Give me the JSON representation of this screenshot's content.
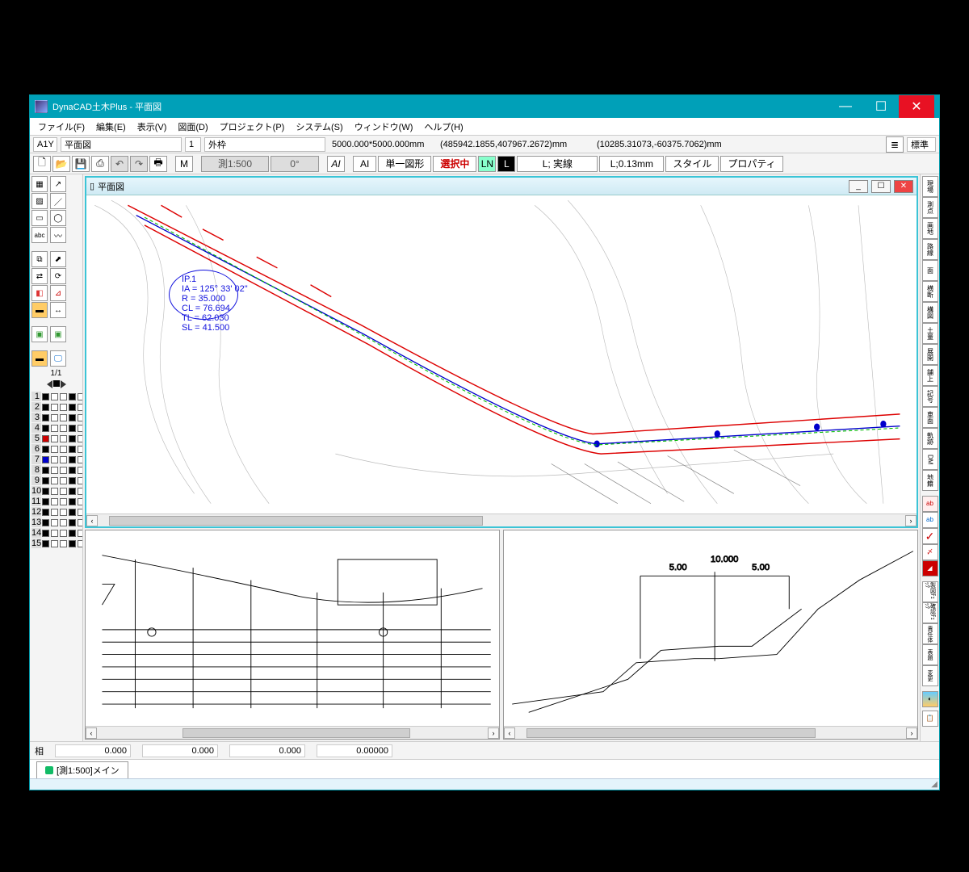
{
  "title": "DynaCAD土木Plus - 平面図",
  "menu": [
    "ファイル(F)",
    "編集(E)",
    "表示(V)",
    "図面(D)",
    "プロジェクト(P)",
    "システム(S)",
    "ウィンドウ(W)",
    "ヘルプ(H)"
  ],
  "info": {
    "cell": "A1Y",
    "name": "平面図",
    "sheet": "1",
    "frame": "外枠",
    "size": "5000.000*5000.000mm",
    "world": "(485942.1855,407967.2672)mm",
    "local": "(10285.31073,-60375.7062)mm",
    "mode": "標準"
  },
  "tool": {
    "scale": "測1:500",
    "angle": "0°",
    "ai1": "AI",
    "ai2": "AI",
    "single": "単一図形",
    "select": "選択中",
    "ln": "LN",
    "l": "L",
    "linetype": "L; 実線",
    "linewidth": "L;0.13mm",
    "style": "スタイル",
    "prop": "プロパティ"
  },
  "docwin": {
    "title": "平面図"
  },
  "curve": {
    "ip": "IP.1",
    "ia": "IA =  125° 33' 02\"",
    "r": "R  =   35.000",
    "cl": "CL =   76.694",
    "tl": "TL =   62.030",
    "sl": "SL =   41.500"
  },
  "page": "1/1",
  "layers": [
    1,
    2,
    3,
    4,
    5,
    6,
    7,
    8,
    9,
    10,
    11,
    12,
    13,
    14,
    15
  ],
  "status": {
    "label": "相",
    "x": "0.000",
    "y": "0.000",
    "z": "0.000",
    "a": "0.00000"
  },
  "tab": "[測1:500]メイン",
  "right_labels": [
    "現場",
    "測点",
    "画地",
    "路線",
    "面",
    "横断",
    "構図",
    "土量",
    "展開",
    "舗上",
    "記号",
    "車面",
    "軌跡",
    "DM",
    "地籍"
  ],
  "right_icons": [
    "ab",
    "ab",
    "✓",
    "〆",
    "◢"
  ],
  "right_checks": [
    "製図ﾁｪｯｸ",
    "確認ﾁｪｯｸ",
    "責任体",
    "表題",
    "変更"
  ]
}
